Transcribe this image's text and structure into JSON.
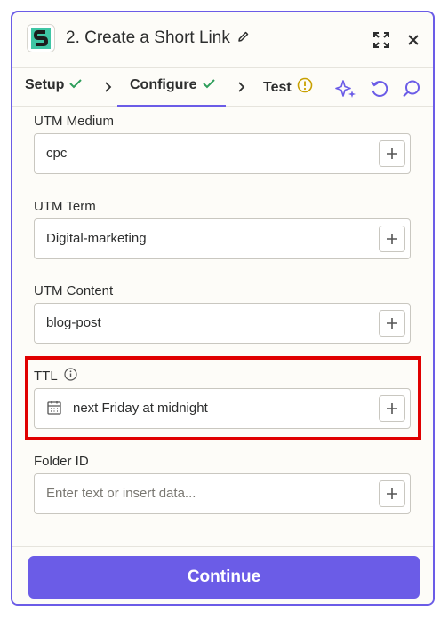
{
  "header": {
    "title": "2. Create a Short Link",
    "icons": [
      "short-io-logo",
      "pencil-icon",
      "expand-icon",
      "close-icon"
    ]
  },
  "tabs": [
    {
      "label": "Setup",
      "status": "check"
    },
    {
      "label": "Configure",
      "status": "check",
      "active": true
    },
    {
      "label": "Test",
      "status": "warning"
    }
  ],
  "toolbar": {
    "icons": [
      "sparkle-icon",
      "undo-icon",
      "search-icon"
    ]
  },
  "fields": {
    "utm_medium": {
      "label": "UTM Medium",
      "value": "cpc"
    },
    "utm_term": {
      "label": "UTM Term",
      "value": "Digital-marketing"
    },
    "utm_content": {
      "label": "UTM Content",
      "value": "blog-post"
    },
    "ttl": {
      "label": "TTL",
      "value": "next Friday at midnight"
    },
    "folder_id": {
      "label": "Folder ID",
      "value": "",
      "placeholder": "Enter text or insert data..."
    }
  },
  "footer": {
    "continue_label": "Continue"
  },
  "colors": {
    "accent": "#6b5ce7",
    "success": "#2e9e5b",
    "warning": "#c8a000",
    "highlight": "#e00000"
  }
}
